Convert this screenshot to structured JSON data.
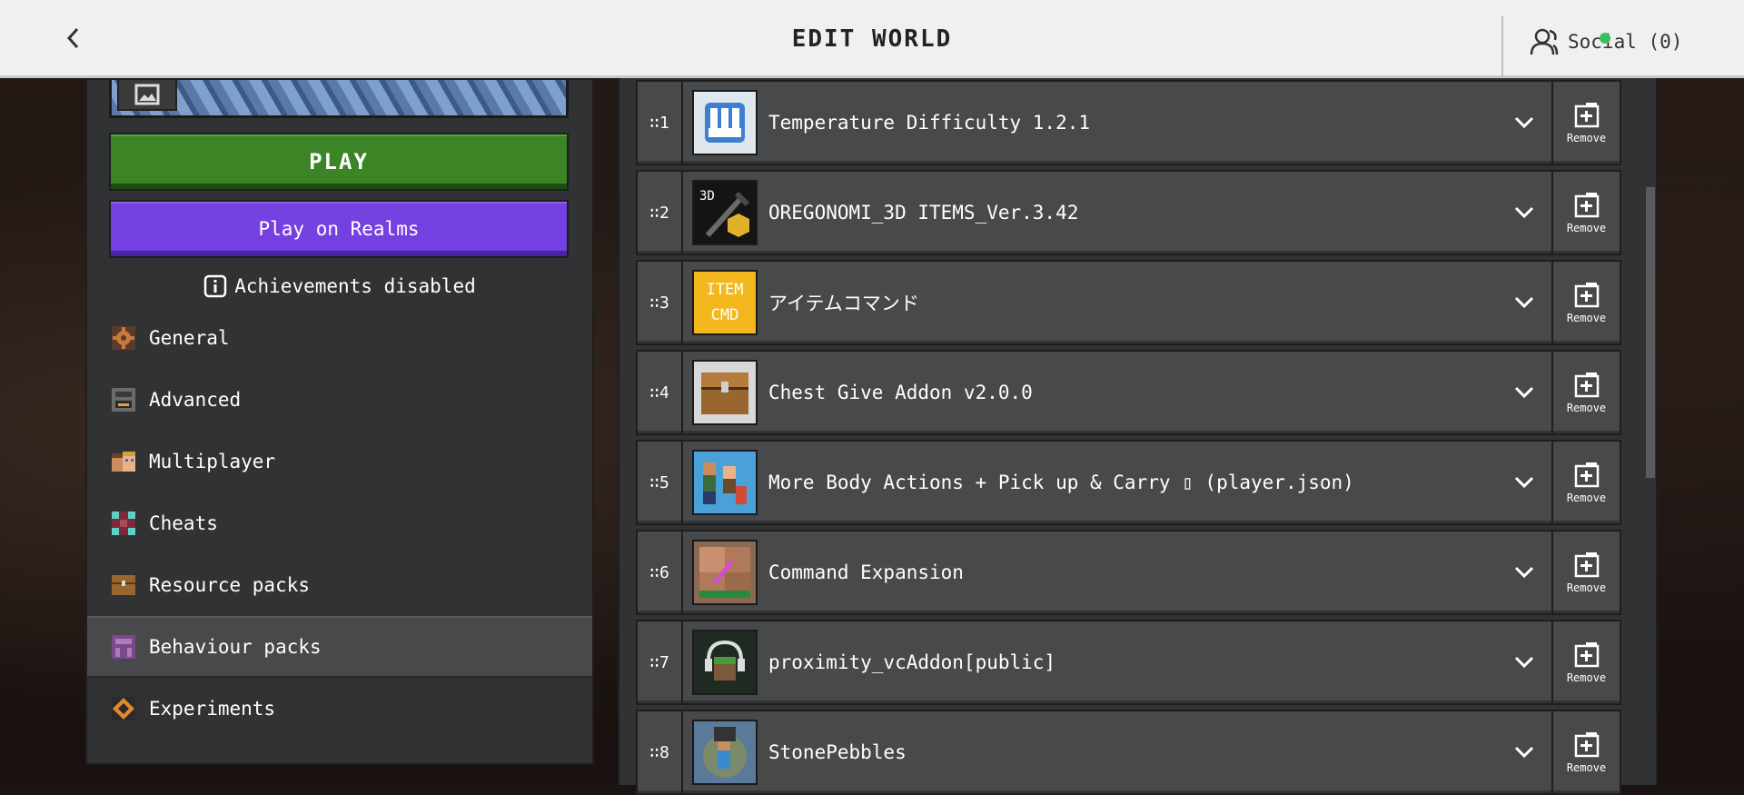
{
  "header": {
    "title": "EDIT WORLD",
    "social_label": "Social (0)"
  },
  "left": {
    "play_label": "PLAY",
    "realms_label": "Play on Realms",
    "achievements_label": "Achievements disabled",
    "nav": [
      {
        "label": "General",
        "icon": "gear-icon"
      },
      {
        "label": "Advanced",
        "icon": "furnace-icon"
      },
      {
        "label": "Multiplayer",
        "icon": "players-icon"
      },
      {
        "label": "Cheats",
        "icon": "command-block-icon"
      },
      {
        "label": "Resource packs",
        "icon": "chest-icon"
      },
      {
        "label": "Behaviour packs",
        "icon": "behaviour-icon",
        "active": true
      },
      {
        "label": "Experiments",
        "icon": "experiments-icon"
      }
    ]
  },
  "packs": [
    {
      "num": "1",
      "name": "Temperature Difficulty 1.2.1"
    },
    {
      "num": "2",
      "name": "OREGONOMI_3D ITEMS_Ver.3.42"
    },
    {
      "num": "3",
      "name": "アイテムコマンド",
      "thumb_text_top": "ITEM",
      "thumb_text_bottom": "CMD"
    },
    {
      "num": "4",
      "name": "Chest Give Addon v2.0.0"
    },
    {
      "num": "5",
      "name": "More Body Actions + Pick up & Carry ▯ (player.json)"
    },
    {
      "num": "6",
      "name": "Command Expansion"
    },
    {
      "num": "7",
      "name": "proximity_vcAddon[public]"
    },
    {
      "num": "8",
      "name": "StonePebbles"
    }
  ],
  "remove_label": "Remove",
  "thumb_3d_label": "3D",
  "colors": {
    "play_green": "#3c8527",
    "realms_purple": "#7540e0",
    "social_dot": "#3bbf5a"
  }
}
